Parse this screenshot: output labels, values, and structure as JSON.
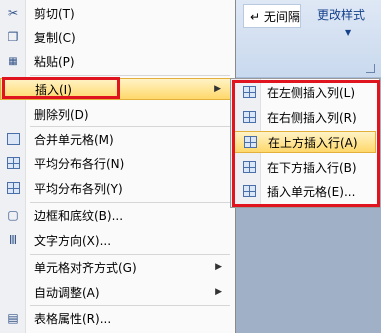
{
  "ribbon": {
    "style_text": "↵ 无间隔",
    "more_styles": "更改样式",
    "caret": "▼"
  },
  "menu": {
    "items": [
      {
        "label": "剪切(T)",
        "icon": "scissors-icon",
        "glyph": "✂"
      },
      {
        "label": "复制(C)",
        "icon": "copy-icon",
        "glyph": "❐"
      },
      {
        "label": "粘贴(P)",
        "icon": "paste-icon",
        "glyph": "📋"
      },
      {
        "label": "插入(I)",
        "icon": "insert-icon",
        "glyph": "",
        "submenu": true,
        "highlighted": true
      },
      {
        "label": "删除列(D)",
        "icon": "",
        "glyph": ""
      },
      {
        "label": "合并单元格(M)",
        "icon": "merge-cells-icon",
        "glyph": "▭"
      },
      {
        "label": "平均分布各行(N)",
        "icon": "distribute-rows-icon",
        "glyph": "⊞"
      },
      {
        "label": "平均分布各列(Y)",
        "icon": "distribute-columns-icon",
        "glyph": "⊞"
      },
      {
        "label": "边框和底纹(B)...",
        "icon": "borders-icon",
        "glyph": "▢"
      },
      {
        "label": "文字方向(X)...",
        "icon": "text-direction-icon",
        "glyph": "Ⅲ"
      },
      {
        "label": "单元格对齐方式(G)",
        "icon": "",
        "glyph": "",
        "submenu": true
      },
      {
        "label": "自动调整(A)",
        "icon": "",
        "glyph": "",
        "submenu": true
      },
      {
        "label": "表格属性(R)...",
        "icon": "table-properties-icon",
        "glyph": "▤"
      }
    ],
    "arrow": "▶"
  },
  "submenu": {
    "items": [
      {
        "label": "在左侧插入列(L)",
        "icon": "insert-column-left-icon"
      },
      {
        "label": "在右侧插入列(R)",
        "icon": "insert-column-right-icon"
      },
      {
        "label": "在上方插入行(A)",
        "icon": "insert-row-above-icon",
        "highlighted": true
      },
      {
        "label": "在下方插入行(B)",
        "icon": "insert-row-below-icon"
      },
      {
        "label": "插入单元格(E)...",
        "icon": "insert-cells-icon"
      }
    ]
  }
}
